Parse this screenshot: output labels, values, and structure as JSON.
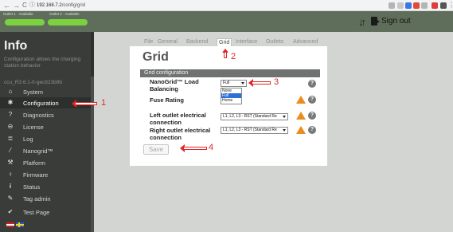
{
  "browser": {
    "back": "←",
    "forward": "→",
    "reload": "C",
    "info": "ⓘ",
    "host": "192.168.7.2",
    "path": "/config/grid"
  },
  "header": {
    "outlets": [
      {
        "label": "Outlet 1 · Available",
        "status_color": "#7cd13f"
      },
      {
        "label": "Outlet 2 · Available",
        "status_color": "#7cd13f"
      }
    ],
    "switch_icon": "swap-arrows-icon",
    "signout_label": "Sign out"
  },
  "sidebar": {
    "title": "Info",
    "subtitle": "Configuration allows the charging station behavior",
    "version": "ccu_R3.6.1-0-gec823b9b",
    "items": [
      {
        "label": "System",
        "icon": "⌂",
        "icon_name": "home-icon",
        "active": false
      },
      {
        "label": "Configuration",
        "icon": "✱",
        "icon_name": "gear-icon",
        "active": true
      },
      {
        "label": "Diagnostics",
        "icon": "?",
        "icon_name": "question-icon",
        "active": false
      },
      {
        "label": "License",
        "icon": "⊖",
        "icon_name": "lock-icon",
        "active": false
      },
      {
        "label": "Log",
        "icon": "≣",
        "icon_name": "list-icon",
        "active": false
      },
      {
        "label": "Nanogrid™",
        "icon": "⁄",
        "icon_name": "nanogrid-icon",
        "active": false
      },
      {
        "label": "Platform",
        "icon": "⚒",
        "icon_name": "wrench-icon",
        "active": false
      },
      {
        "label": "Firmware",
        "icon": "♀",
        "icon_name": "firmware-icon",
        "active": false
      },
      {
        "label": "Status",
        "icon": "i",
        "icon_name": "info-icon",
        "active": false
      },
      {
        "label": "Tag admin",
        "icon": "✎",
        "icon_name": "tag-icon",
        "active": false
      },
      {
        "label": "Test Page",
        "icon": "✔",
        "icon_name": "check-icon",
        "active": false
      }
    ]
  },
  "tabs": [
    {
      "label": "File",
      "active": false
    },
    {
      "label": "General",
      "active": false
    },
    {
      "label": "Backend",
      "active": false
    },
    {
      "label": "Grid",
      "active": true
    },
    {
      "label": "Interface",
      "active": false
    },
    {
      "label": "Outlets",
      "active": false
    },
    {
      "label": "Advanced",
      "active": false
    }
  ],
  "content": {
    "title": "Grid",
    "section": "Grid configuration",
    "fields": {
      "load_balancing": {
        "label": "NanoGrid™ Load Balancing",
        "value": "Full",
        "options": [
          "None",
          "Full",
          "Home"
        ],
        "selected_option": "Full"
      },
      "fuse_rating": {
        "label": "Fuse Rating"
      },
      "left_outlet": {
        "label": "Left outlet electrical connection",
        "value": "L1, L2, L3 - RST (Standard Re"
      },
      "right_outlet": {
        "label": "Right outlet electrical connection",
        "value": "L1, L2, L3 - RST (Standard Re"
      }
    },
    "help_glyph": "?",
    "save_label": "Save"
  },
  "annotations": {
    "n1": "1",
    "n2": "2",
    "n3": "3",
    "n4": "4",
    "color": "#e02626"
  },
  "colors": {
    "sidebar": "#3a3c3a",
    "header": "#5f6e5a",
    "content_bg": "#d3d5d3",
    "status_green": "#7cd13f",
    "warning": "#ec8c1c"
  }
}
